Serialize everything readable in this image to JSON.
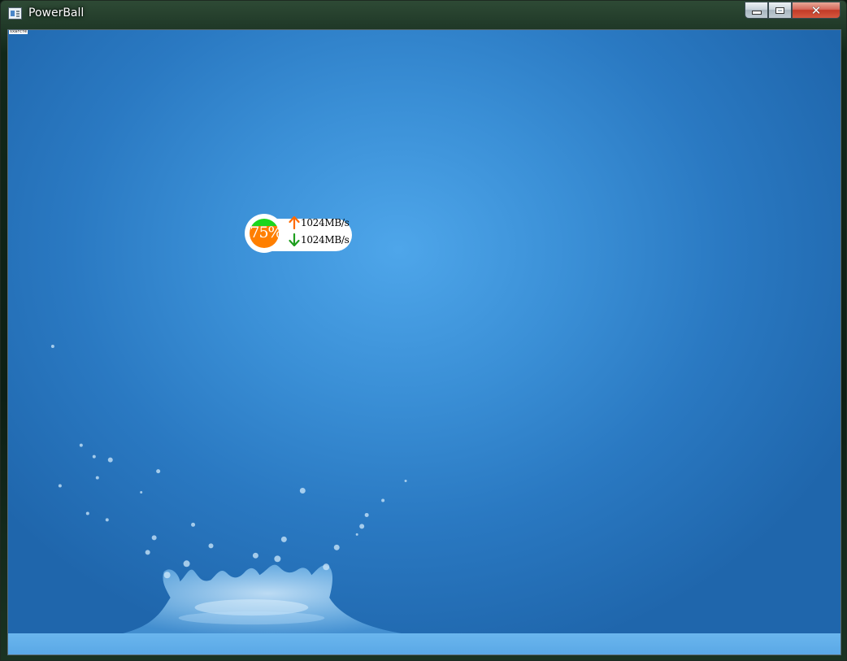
{
  "window": {
    "title": "PowerBall",
    "tiny_label": "sxarcfe"
  },
  "caption_buttons": {
    "minimize_icon": "minimize-icon",
    "maximize_icon": "maximize-icon",
    "close_icon": "close-icon",
    "close_color": "#c23a27"
  },
  "widget": {
    "percent_text": "75%",
    "fill_level": 0.75,
    "fill_color": "#ff7f00",
    "empty_color": "#1dd61d",
    "upload": {
      "icon": "arrow-up-icon",
      "icon_color": "#ff6a00",
      "text": "1024MB/s"
    },
    "download": {
      "icon": "arrow-down-icon",
      "icon_color": "#1e9e1e",
      "text": "1024MB/s"
    }
  },
  "background": {
    "color_center": "#4ea6ea",
    "color_edge": "#1f66ac"
  }
}
